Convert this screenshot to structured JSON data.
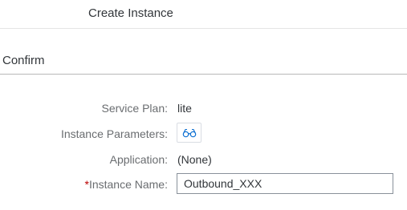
{
  "dialog": {
    "title": "Create Instance"
  },
  "section": {
    "title": "Confirm"
  },
  "form": {
    "service_plan": {
      "label": "Service Plan:",
      "value": "lite"
    },
    "instance_parameters": {
      "label": "Instance Parameters:",
      "icon": "glasses-icon"
    },
    "application": {
      "label": "Application:",
      "value": "(None)"
    },
    "instance_name": {
      "required_marker": "*",
      "label": "Instance Name:",
      "value": "Outbound_XXX"
    }
  },
  "colors": {
    "required": "#bb0000",
    "label_text": "#6a6d70",
    "value_text": "#32363a",
    "icon_accent": "#0a6ed1",
    "section_rule": "#b8b8b8"
  }
}
